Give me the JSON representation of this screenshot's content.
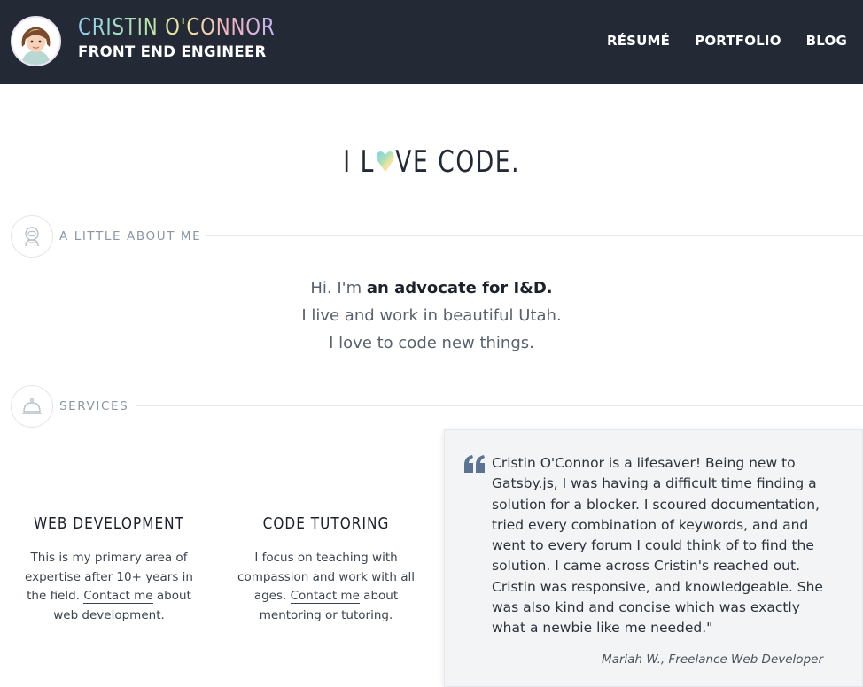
{
  "header": {
    "name": "CRISTIN O'CONNOR",
    "title": "FRONT END ENGINEER",
    "nav": [
      "RÉSUMÉ",
      "PORTFOLIO",
      "BLOG"
    ]
  },
  "hero": {
    "prefix": "I L",
    "suffix": "VE CODE.",
    "heart_icon": "rainbow-heart-icon"
  },
  "sections": {
    "about": {
      "label": "A LITTLE ABOUT ME",
      "icon": "astronaut-icon"
    },
    "services": {
      "label": "SERVICES",
      "icon": "service-bell-icon"
    }
  },
  "about": {
    "line1_prefix": "Hi. I'm ",
    "line1_bold": "an advocate for I&D.",
    "line2": "I live and work in beautiful Utah.",
    "line3": "I love to code new things."
  },
  "services": [
    {
      "title": "WEB DEVELOPMENT",
      "text_before": "This is my primary area of expertise after 10+ years in the field. ",
      "link": "Contact me",
      "text_after": " about web development."
    },
    {
      "title": "CODE TUTORING",
      "text_before": "I focus on teaching with compassion and work with all ages. ",
      "link": "Contact me",
      "text_after": " about mentoring or tutoring."
    }
  ],
  "testimonial": {
    "quote": "Cristin O'Connor is a lifesaver! Being new to Gatsby.js, I was having a difficult time finding a solution for a blocker. I scoured documentation, tried every combination of keywords, and and went to every forum I could think of to find the solution. I came across Cristin's reached out. Cristin was responsive, and knowledgeable. She was also kind and concise which was exactly what a newbie like me needed.\"",
    "author": "– Mariah W., Freelance Web Developer",
    "icon": "quote-icon"
  },
  "colors": {
    "header_bg": "#232a35",
    "quote_accent": "#5a7394",
    "muted_label": "#8a96a3"
  }
}
